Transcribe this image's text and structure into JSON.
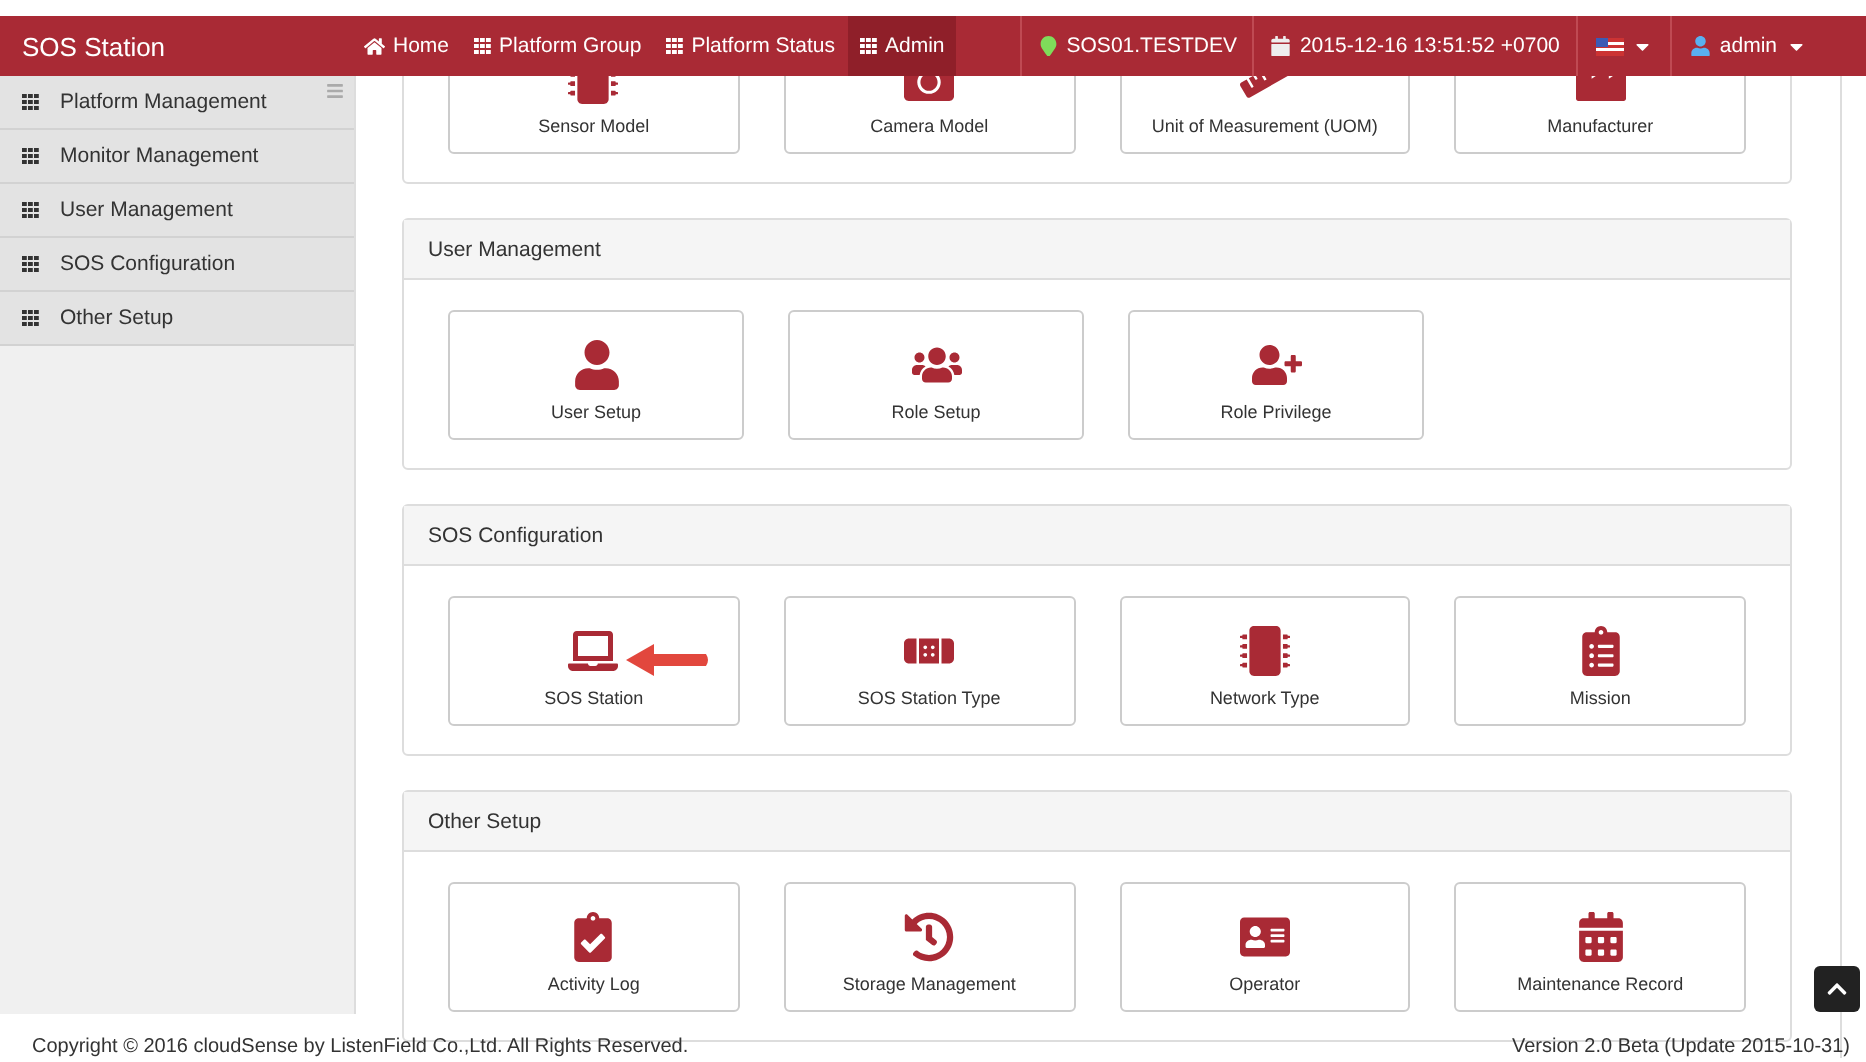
{
  "brand": "SOS Station",
  "nav": [
    {
      "label": "Home",
      "selected": false
    },
    {
      "label": "Platform Group",
      "selected": false
    },
    {
      "label": "Platform Status",
      "selected": false
    },
    {
      "label": "Admin",
      "selected": true
    }
  ],
  "station": "SOS01.TESTDEV",
  "datetime": "2015-12-16 13:51:52 +0700",
  "user": "admin",
  "sidebar": [
    {
      "label": "Platform Management"
    },
    {
      "label": "Monitor Management"
    },
    {
      "label": "User Management"
    },
    {
      "label": "SOS Configuration"
    },
    {
      "label": "Other Setup"
    }
  ],
  "sections": [
    {
      "cards": [
        "Sensor Model",
        "Camera Model",
        "Unit of Measurement (UOM)",
        "Manufacturer"
      ]
    },
    {
      "title": "User Management",
      "cards": [
        "User Setup",
        "Role Setup",
        "Role Privilege"
      ]
    },
    {
      "title": "SOS Configuration",
      "cards": [
        "SOS Station",
        "SOS Station Type",
        "Network Type",
        "Mission"
      ]
    },
    {
      "title": "Other Setup",
      "cards": [
        "Activity Log",
        "Storage Management",
        "Operator",
        "Maintenance Record"
      ]
    }
  ],
  "footer": {
    "copyright": "Copyright © 2016 cloudSense by ListenField Co.,Ltd. All Rights Reserved.",
    "version": "Version 2.0 Beta (Update 2015-10-31)"
  }
}
